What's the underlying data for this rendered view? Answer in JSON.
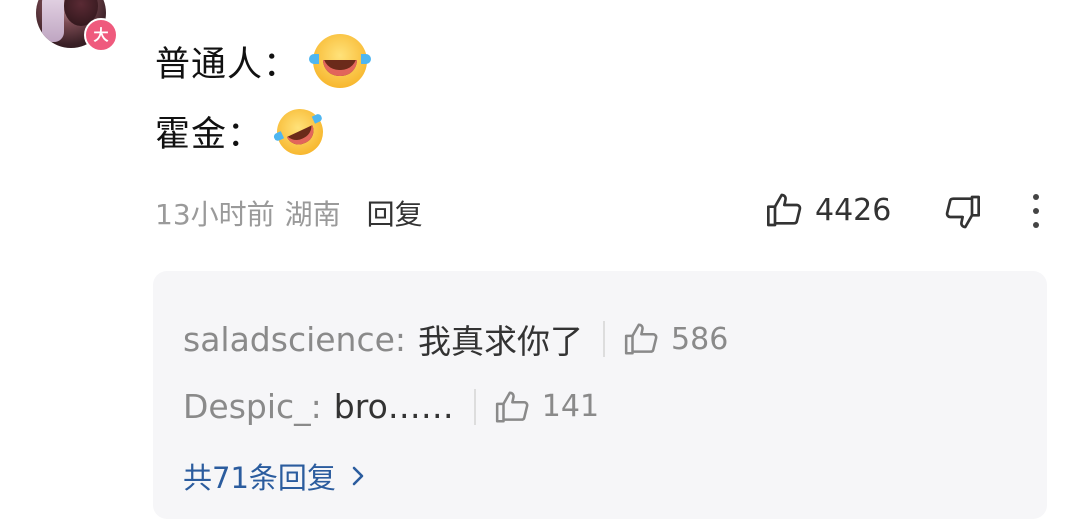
{
  "comment": {
    "user_badge": "大",
    "lines": [
      {
        "label": "普通人：",
        "emoji": "face-with-tears-of-joy"
      },
      {
        "label": "霍金：",
        "emoji": "rolling-on-the-floor-laughing"
      }
    ],
    "meta": {
      "time": "13小时前",
      "location": "湖南",
      "reply_label": "回复"
    },
    "likes": "4426"
  },
  "replies": {
    "items": [
      {
        "user": "saladscience:",
        "text": "我真求你了",
        "likes": "586"
      },
      {
        "user": "Despic_:",
        "text": "bro……",
        "likes": "141"
      }
    ],
    "more_label": "共71条回复"
  },
  "colors": {
    "badge": "#ef5a7d",
    "reply_panel_bg": "#f6f6f8",
    "link_blue": "#2b5c9e",
    "meta_gray": "#9a9a9a"
  }
}
